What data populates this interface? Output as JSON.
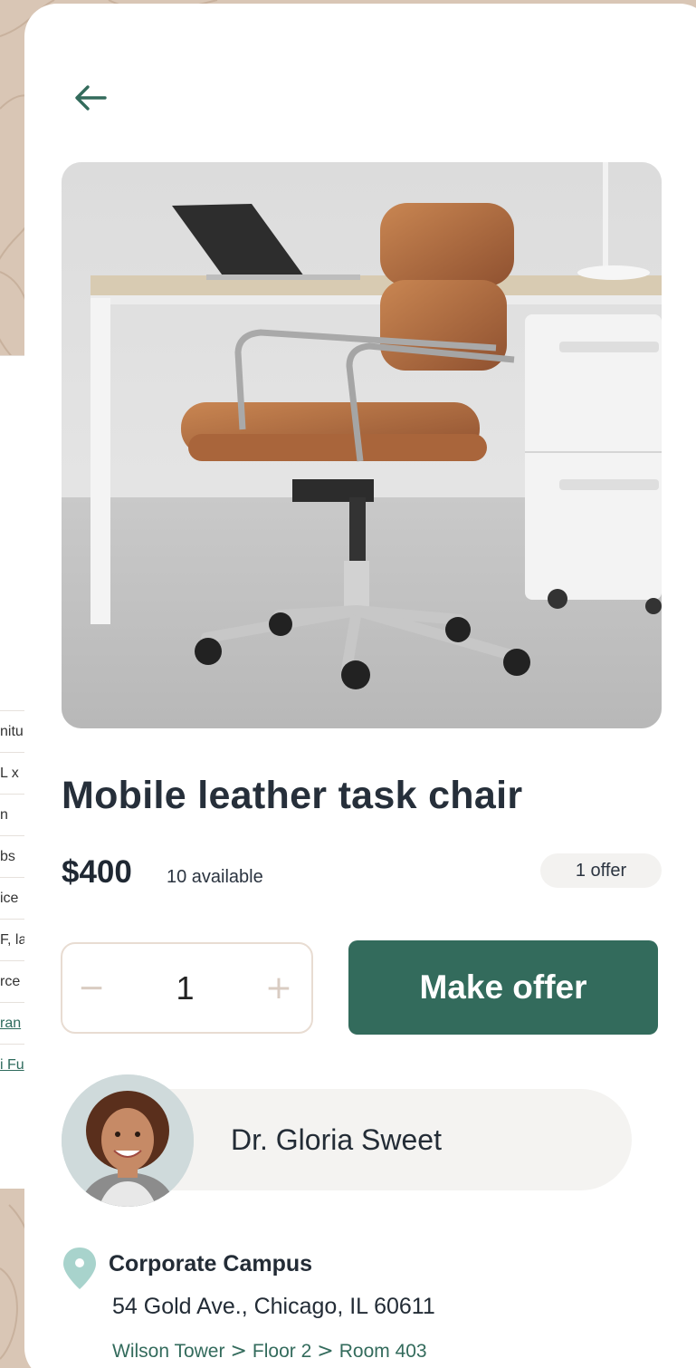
{
  "underlying_table": {
    "rows": [
      "nitu",
      "L x",
      "n",
      "bs",
      "ice",
      "F, la",
      "rce",
      "ran",
      "i Fu"
    ]
  },
  "product": {
    "title": "Mobile leather task chair",
    "price": "$400",
    "availability": "10 available",
    "offers": "1 offer",
    "image_alt": "chair-photo"
  },
  "stepper": {
    "decrement": "−",
    "quantity": "1",
    "increment": "+"
  },
  "actions": {
    "make_offer": "Make offer"
  },
  "seller": {
    "name": "Dr. Gloria Sweet"
  },
  "location": {
    "name": "Corporate Campus",
    "address": "54 Gold Ave., Chicago, IL 60611",
    "path": [
      "Wilson Tower",
      "Floor 2",
      "Room 403"
    ]
  },
  "colors": {
    "accent": "#336b5c",
    "background": "#d9c6b5",
    "pin": "#a8d3cc"
  }
}
